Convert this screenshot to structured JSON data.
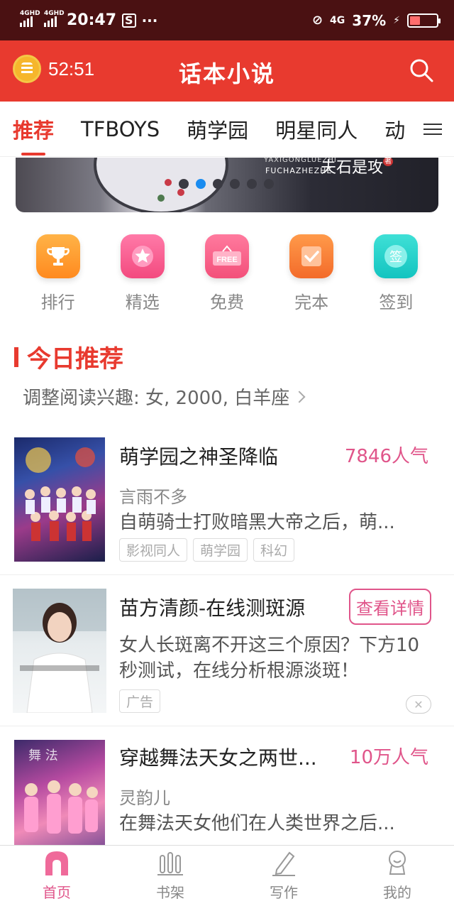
{
  "status_bar": {
    "signal1_tag": "4GHD",
    "signal2_tag": "4GHD",
    "time": "20:47",
    "network": "4G",
    "battery": "37%"
  },
  "header": {
    "timer": "52:51",
    "title": "话本小说"
  },
  "tabs": [
    "推荐",
    "TFBOYS",
    "萌学园",
    "明星同人",
    "动"
  ],
  "banner": {
    "pinyin_line1": "YAXIGONGLUEZHI",
    "pinyin_line2": "FUCHAZHEZHE",
    "title": "夫石是攻",
    "badge": "著"
  },
  "quick_actions": [
    {
      "label": "排行",
      "icon": "trophy-icon"
    },
    {
      "label": "精选",
      "icon": "star-icon"
    },
    {
      "label": "免费",
      "icon": "free-tag-icon"
    },
    {
      "label": "完本",
      "icon": "checkmark-icon"
    },
    {
      "label": "签到",
      "icon": "sign-in-icon"
    }
  ],
  "section": {
    "title": "今日推荐",
    "interest": "调整阅读兴趣: 女, 2000, 白羊座"
  },
  "items": [
    {
      "title": "萌学园之神圣降临",
      "popularity": "7846人气",
      "author": "言雨不多",
      "desc": "自萌骑士打败暗黑大帝之后，萌...",
      "tags": [
        "影视同人",
        "萌学园",
        "科幻"
      ]
    },
    {
      "title": "苗方清颜-在线测斑源",
      "button": "查看详情",
      "desc": "女人长斑离不开这三个原因？下方10秒测试，在线分析根源淡斑！",
      "tag": "广告"
    },
    {
      "title": "穿越舞法天女之两世...",
      "popularity": "10万人气",
      "author": "灵韵儿",
      "desc": "在舞法天女他们在人类世界之后..."
    }
  ],
  "bottom_nav": [
    {
      "label": "首页",
      "icon": "home-icon"
    },
    {
      "label": "书架",
      "icon": "bookshelf-icon"
    },
    {
      "label": "写作",
      "icon": "pen-icon"
    },
    {
      "label": "我的",
      "icon": "profile-icon"
    }
  ],
  "colors": {
    "status_bar": "#4a1112",
    "header": "#e83a2f",
    "accent_pink": "#e0558a"
  }
}
